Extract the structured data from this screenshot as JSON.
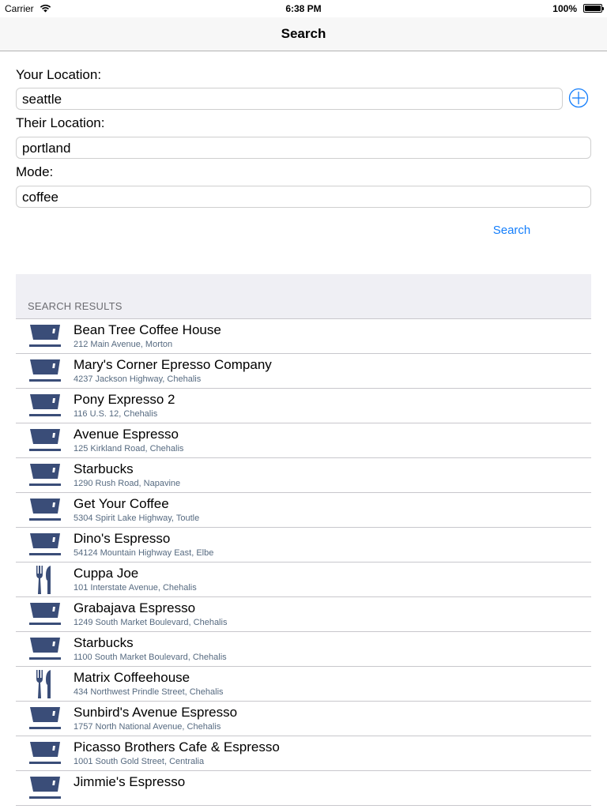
{
  "status_bar": {
    "carrier": "Carrier",
    "time": "6:38 PM",
    "battery": "100%"
  },
  "nav": {
    "title": "Search"
  },
  "form": {
    "your_location_label": "Your Location:",
    "your_location_value": "seattle",
    "their_location_label": "Their Location:",
    "their_location_value": "portland",
    "mode_label": "Mode:",
    "mode_value": "coffee",
    "search_label": "Search"
  },
  "results": {
    "header": "SEARCH RESULTS",
    "items": [
      {
        "name": "Bean Tree Coffee House",
        "address": "212 Main Avenue, Morton",
        "icon": "coffee-cup-icon"
      },
      {
        "name": "Mary's Corner Epresso Company",
        "address": "4237 Jackson Highway, Chehalis",
        "icon": "coffee-cup-icon"
      },
      {
        "name": "Pony Expresso 2",
        "address": "116 U.S. 12, Chehalis",
        "icon": "coffee-cup-icon"
      },
      {
        "name": "Avenue Espresso",
        "address": "125 Kirkland Road, Chehalis",
        "icon": "coffee-cup-icon"
      },
      {
        "name": "Starbucks",
        "address": "1290 Rush Road, Napavine",
        "icon": "coffee-cup-icon"
      },
      {
        "name": "Get Your Coffee",
        "address": "5304 Spirit Lake Highway, Toutle",
        "icon": "coffee-cup-icon"
      },
      {
        "name": "Dino's Espresso",
        "address": "54124 Mountain Highway East, Elbe",
        "icon": "coffee-cup-icon"
      },
      {
        "name": "Cuppa Joe",
        "address": "101 Interstate Avenue, Chehalis",
        "icon": "fork-knife-icon"
      },
      {
        "name": "Grabajava Espresso",
        "address": "1249 South Market Boulevard, Chehalis",
        "icon": "coffee-cup-icon"
      },
      {
        "name": "Starbucks",
        "address": "1100 South Market Boulevard, Chehalis",
        "icon": "coffee-cup-icon"
      },
      {
        "name": "Matrix Coffeehouse",
        "address": "434 Northwest Prindle Street, Chehalis",
        "icon": "fork-knife-icon"
      },
      {
        "name": "Sunbird's Avenue Espresso",
        "address": "1757 North National Avenue, Chehalis",
        "icon": "coffee-cup-icon"
      },
      {
        "name": "Picasso Brothers Cafe & Espresso",
        "address": "1001 South Gold Street, Centralia",
        "icon": "coffee-cup-icon"
      },
      {
        "name": "Jimmie's Espresso",
        "address": "",
        "icon": "coffee-cup-icon"
      }
    ]
  },
  "colors": {
    "accent": "#147efb",
    "icon": "#3a4d78",
    "separator": "#c8c7cc"
  }
}
